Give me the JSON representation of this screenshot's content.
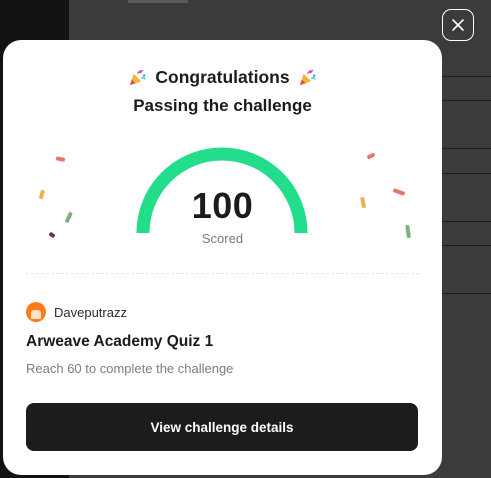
{
  "modal": {
    "title": "Congratulations",
    "subtitle": "Passing the challenge",
    "score": {
      "value": "100",
      "label": "Scored",
      "fill_percent": 100,
      "accent_color": "#22dd8a"
    },
    "author": {
      "name": "Daveputrazz"
    },
    "challenge": {
      "title": "Arweave Academy Quiz 1",
      "description": "Reach 60 to complete the challenge"
    },
    "cta_label": "View challenge details"
  },
  "icons": {
    "close": "close-icon",
    "celebrate": "party-popper-icon"
  },
  "colors": {
    "primary_button": "#1c1c1c",
    "accent": "#22dd8a",
    "overlay": "#3b3b3b"
  }
}
